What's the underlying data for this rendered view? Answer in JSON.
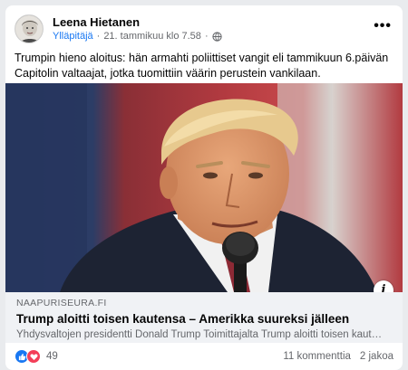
{
  "post": {
    "author": "Leena Hietanen",
    "role": "Ylläpitäjä",
    "separator": "·",
    "timestamp": "21. tammikuu klo 7.58",
    "separator2": "·",
    "more": "•••",
    "text": "Trumpin hieno aloitus: hän armahti poliittiset vangit eli tammikuun 6.päivän Capitolin valtaajat, jotka tuomittiin väärin perustein vankilaan."
  },
  "link": {
    "domain": "NAAPURISEURA.FI",
    "title": "Trump aloitti toisen kautensa – Amerikka suureksi jälleen",
    "description": "Yhdysvaltojen presidentti Donald Trump Toimittajalta Trump aloitti toisen kaut…",
    "info_icon": "i"
  },
  "stats": {
    "reaction_count": "49",
    "comments": "11 kommenttia",
    "shares": "2 jakoa"
  },
  "icons": {
    "globe": "globe-icon",
    "like": "like-icon",
    "love": "love-icon",
    "info": "info-icon",
    "more": "more-options-icon"
  },
  "colors": {
    "accent": "#1877f2",
    "love": "#f33e58",
    "secondary_text": "#65676b"
  }
}
